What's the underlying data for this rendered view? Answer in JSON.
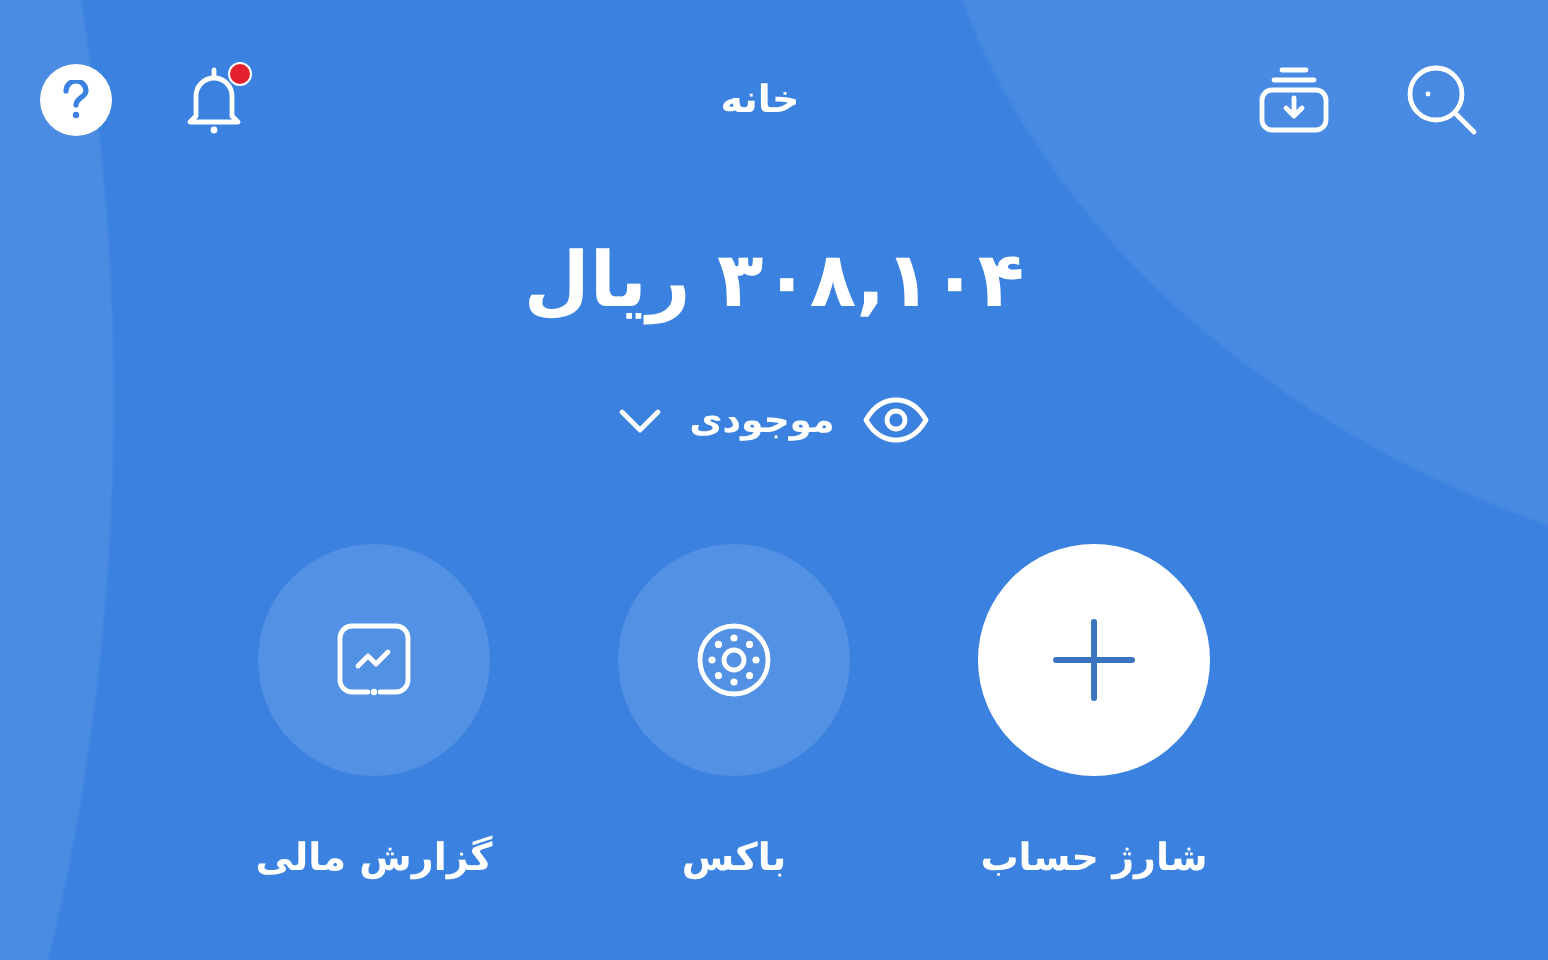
{
  "header": {
    "title": "خانه",
    "notifications_unread": true
  },
  "balance": {
    "amount": "۳۰۸,۱۰۴ ریال",
    "label": "موجودی"
  },
  "actions": [
    {
      "kind": "charge",
      "label": "شارژ حساب"
    },
    {
      "kind": "box",
      "label": "باکس"
    },
    {
      "kind": "report",
      "label": "گزارش مالی"
    }
  ]
}
